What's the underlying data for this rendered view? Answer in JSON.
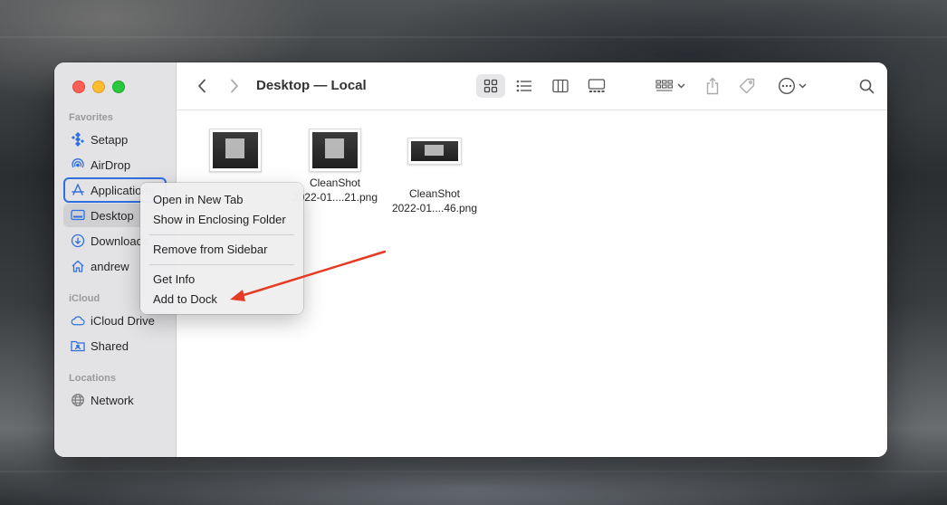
{
  "window": {
    "title": "Desktop — Local"
  },
  "sidebar": {
    "sections": [
      {
        "label": "Favorites"
      },
      {
        "label": "iCloud"
      },
      {
        "label": "Locations"
      }
    ],
    "favorites": [
      {
        "label": "Setapp",
        "icon": "setapp-icon"
      },
      {
        "label": "AirDrop",
        "icon": "airdrop-icon"
      },
      {
        "label": "Applications",
        "icon": "applications-icon"
      },
      {
        "label": "Desktop",
        "icon": "desktop-icon"
      },
      {
        "label": "Downloads",
        "icon": "downloads-icon"
      },
      {
        "label": "andrew",
        "icon": "home-icon"
      }
    ],
    "icloud": [
      {
        "label": "iCloud Drive",
        "icon": "cloud-icon"
      },
      {
        "label": "Shared",
        "icon": "shared-folder-icon"
      }
    ],
    "locations": [
      {
        "label": "Network",
        "icon": "network-icon"
      }
    ]
  },
  "files": [
    {
      "line1": "",
      "line2": ""
    },
    {
      "line1": "CleanShot",
      "line2": "2022-01....21.png"
    },
    {
      "line1": "CleanShot",
      "line2": "2022-01....46.png"
    }
  ],
  "context_menu": {
    "items": [
      {
        "label": "Open in New Tab"
      },
      {
        "label": "Show in Enclosing Folder"
      },
      {
        "label": "Remove from Sidebar"
      },
      {
        "label": "Get Info"
      },
      {
        "label": "Add to Dock"
      }
    ]
  },
  "colors": {
    "accent": "#2f6fe0",
    "annotation_arrow": "#e53a24",
    "sidebar_bg": "#e3e3e5"
  }
}
